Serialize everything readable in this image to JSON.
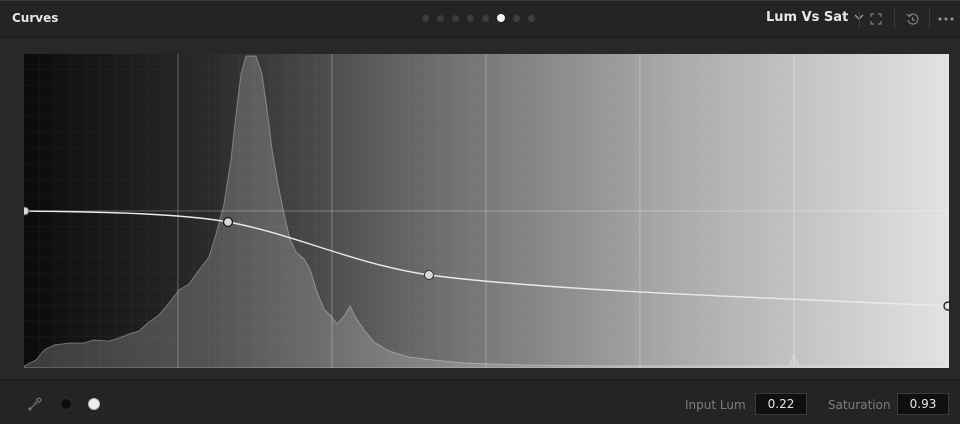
{
  "header": {
    "title": "Curves",
    "mode_label": "Lum Vs Sat",
    "icons": [
      "chevron-down-icon",
      "expand-icon",
      "reset-icon",
      "more-options-icon"
    ]
  },
  "pager": {
    "count": 8,
    "active_index": 5
  },
  "footer": {
    "input_lum_label": "Input Lum",
    "input_lum_value": "0.22",
    "saturation_label": "Saturation",
    "saturation_value": "0.93",
    "icons": [
      "eyedropper-icon",
      "black-point-icon",
      "white-point-icon"
    ]
  },
  "colors": {
    "curve": "#eaeaea",
    "point_fill": "#d8d8d8",
    "panel_bg": "#28282a"
  }
}
